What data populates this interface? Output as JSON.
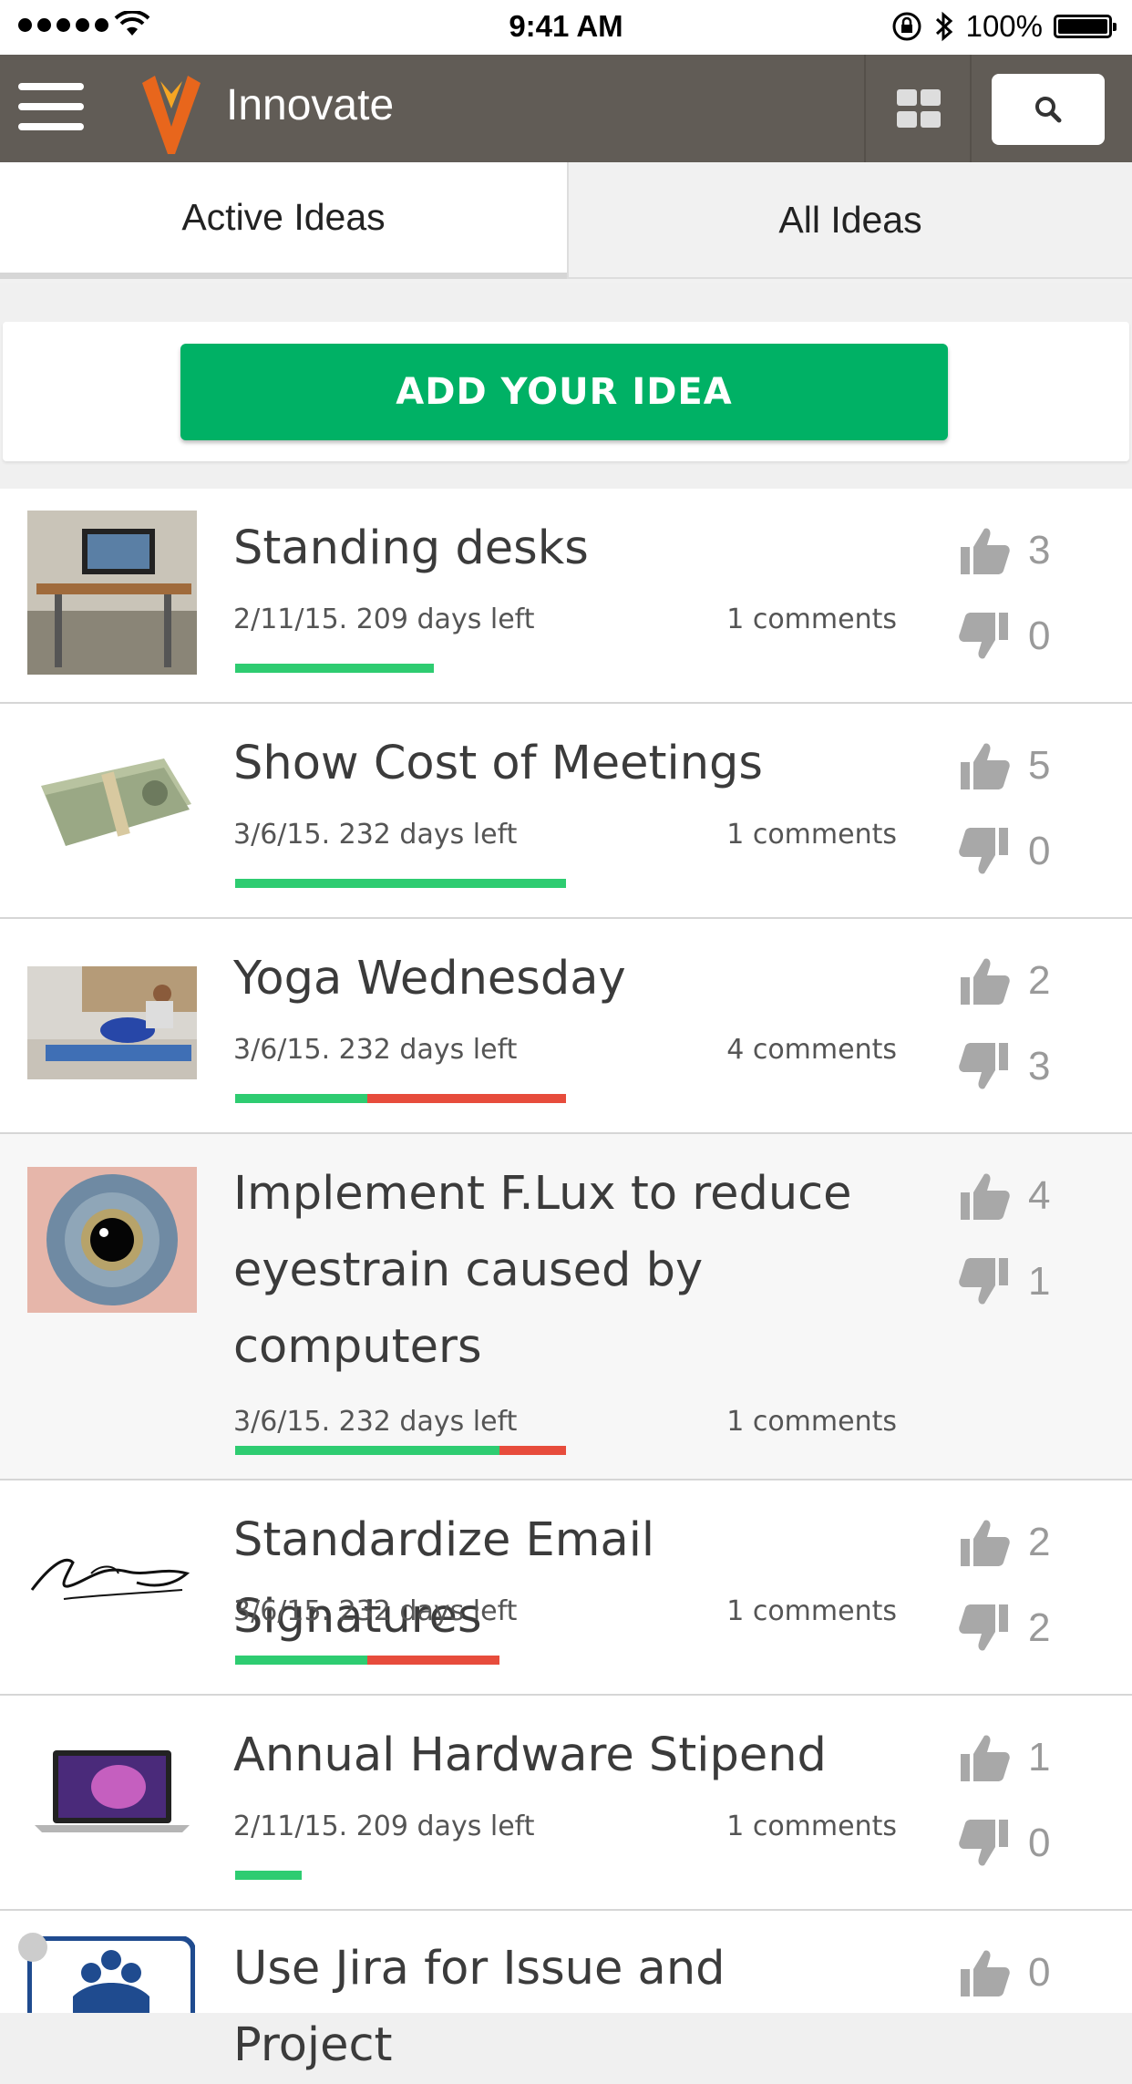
{
  "status_bar": {
    "time": "9:41 AM",
    "battery": "100%"
  },
  "header": {
    "title": "Innovate"
  },
  "tabs": [
    {
      "label": "Active Ideas"
    },
    {
      "label": "All Ideas"
    }
  ],
  "add_idea": {
    "label": "ADD YOUR IDEA"
  },
  "ideas": [
    {
      "title": "Standing desks",
      "meta": "2/11/15. 209 days left",
      "comments": "1 comments",
      "up": "3",
      "down": "0",
      "up_fraction": 1.0,
      "total_fraction": 0.6
    },
    {
      "title": "Show Cost of Meetings",
      "meta": "3/6/15. 232 days left",
      "comments": "1 comments",
      "up": "5",
      "down": "0",
      "up_fraction": 1.0,
      "total_fraction": 1.0
    },
    {
      "title": "Yoga Wednesday",
      "meta": "3/6/15. 232 days left",
      "comments": "4 comments",
      "up": "2",
      "down": "3",
      "up_fraction": 0.4,
      "total_fraction": 1.0
    },
    {
      "title": "Implement F.Lux to reduce eyestrain caused by computers",
      "meta": "3/6/15. 232 days left",
      "comments": "1 comments",
      "up": "4",
      "down": "1",
      "up_fraction": 0.8,
      "total_fraction": 1.0
    },
    {
      "title": "Standardize Email Signatures",
      "meta": "3/6/15. 232 days left",
      "comments": "1 comments",
      "up": "2",
      "down": "2",
      "up_fraction": 0.5,
      "total_fraction": 0.8
    },
    {
      "title": "Annual Hardware Stipend",
      "meta": "2/11/15. 209 days left",
      "comments": "1 comments",
      "up": "1",
      "down": "0",
      "up_fraction": 1.0,
      "total_fraction": 0.2
    },
    {
      "title": "Use Jira for Issue and Project",
      "meta": "",
      "comments": "",
      "up": "0",
      "down": ""
    }
  ]
}
